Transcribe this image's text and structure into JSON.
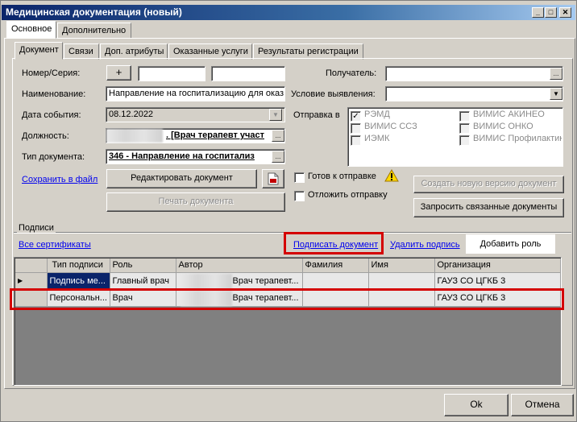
{
  "window": {
    "title": "Медицинская документация (новый)"
  },
  "outer_tabs": [
    "Основное",
    "Дополнительно"
  ],
  "inner_tabs": [
    "Документ",
    "Связи",
    "Доп. атрибуты",
    "Оказанные услуги",
    "Результаты регистрации"
  ],
  "form": {
    "number_label": "Номер/Серия:",
    "plus": "+",
    "name_label": "Наименование:",
    "name_value": "Направление на госпитализацию для оказ",
    "event_date_label": "Дата события:",
    "event_date_value": "08.12.2022",
    "position_label": "Должность:",
    "position_value": ". [Врач терапевт участ",
    "doctype_label": "Тип документа:",
    "doctype_value": "346 - Направление на госпитализ",
    "ellipsis": "...",
    "recipient_label": "Получатель:",
    "condition_label": "Условие выявления:",
    "send_label": "Отправка в",
    "send_options": [
      {
        "label": "РЭМД",
        "checked": true
      },
      {
        "label": "ВИМИС АКИНЕО",
        "checked": false
      },
      {
        "label": "ВИМИС ССЗ",
        "checked": false
      },
      {
        "label": "ВИМИС ОНКО",
        "checked": false
      },
      {
        "label": "ИЭМК",
        "checked": false
      },
      {
        "label": "ВИМИС Профилактика",
        "checked": false
      }
    ],
    "save_to_file": "Сохранить в файл",
    "edit_doc": "Редактировать документ",
    "print_doc": "Печать документа",
    "ready_to_send": "Готов к отправке",
    "delay_send": "Отложить отправку",
    "new_version": "Создать новую версию документ",
    "request_related": "Запросить связанные документы"
  },
  "signatures": {
    "group_label": "Подписи",
    "all_certs": "Все сертификаты",
    "sign_doc": "Подписать документ",
    "delete_sign": "Удалить подпись",
    "add_role": "Добавить роль",
    "columns": [
      "Тип подписи",
      "Роль",
      "Автор",
      "Фамилия",
      "Имя",
      "Организация"
    ],
    "rows": [
      {
        "type": "Подпись ме...",
        "role": "Главный врач",
        "author": "Врач терапевт...",
        "surname": "",
        "name": "",
        "org": "ГАУЗ СО ЦГКБ 3"
      },
      {
        "type": "Персональн...",
        "role": "Врач",
        "author": "Врач терапевт...",
        "surname": "",
        "name": "",
        "org": "ГАУЗ СО ЦГКБ 3"
      }
    ]
  },
  "footer": {
    "ok": "Ok",
    "cancel": "Отмена"
  }
}
